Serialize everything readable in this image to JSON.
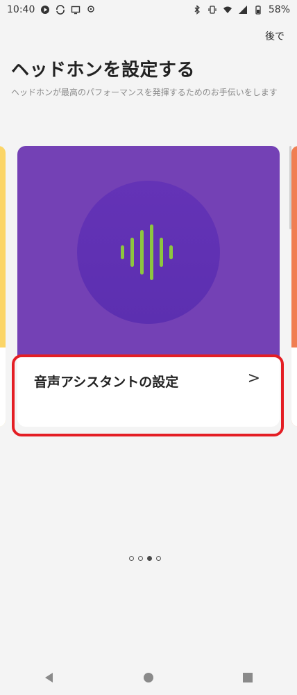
{
  "status_bar": {
    "time": "10:40",
    "battery": "58%"
  },
  "header": {
    "later_label": "後で",
    "title": "ヘッドホンを設定する",
    "subtitle": "ヘッドホンが最高のパフォーマンスを発揮するためのお手伝いをします"
  },
  "card": {
    "label": "音声アシスタントの設定",
    "chevron": ">",
    "colors": {
      "banner": "#7441b5",
      "circle": "#6433b6",
      "wave": "#8dc63f"
    },
    "icon": "sound-wave-icon"
  },
  "pagination": {
    "count": 4,
    "active_index": 2
  },
  "highlight_color": "#e41e24"
}
